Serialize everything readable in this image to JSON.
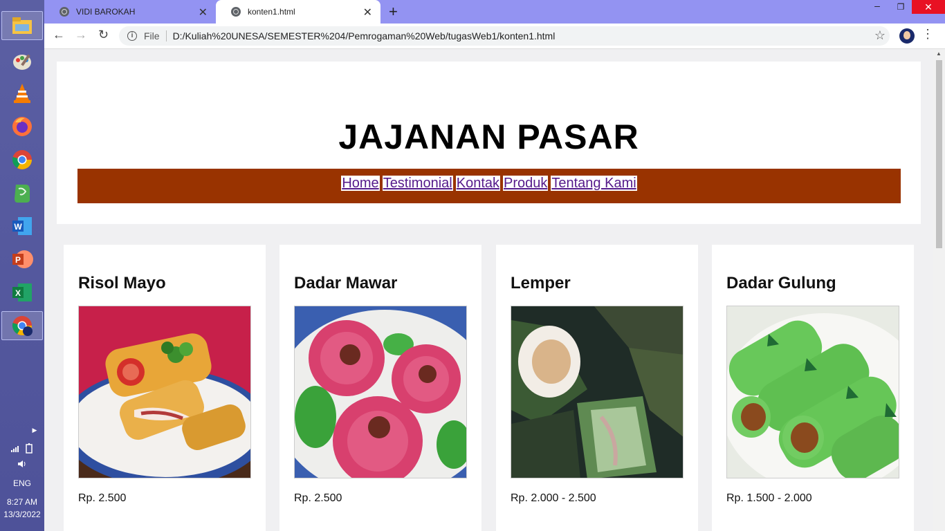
{
  "browser": {
    "tabs": [
      {
        "title": "VIDI BAROKAH"
      },
      {
        "title": "konten1.html"
      }
    ],
    "address": {
      "scheme_label": "File",
      "url": "D:/Kuliah%20UNESA/SEMESTER%204/Pemrogaman%20Web/tugasWeb1/konten1.html"
    }
  },
  "taskbar": {
    "apps": [
      "file-explorer-icon",
      "paint-icon",
      "vlc-icon",
      "firefox-icon",
      "chrome-icon",
      "evernote-icon",
      "word-icon",
      "powerpoint-icon",
      "excel-icon",
      "chrome-profile-icon"
    ],
    "language": "ENG",
    "time": "8:27 AM",
    "date": "13/3/2022"
  },
  "page": {
    "title": "JAJANAN PASAR",
    "nav": [
      "Home",
      "Testimonial",
      "Kontak",
      "Produk",
      "Tentang Kami"
    ],
    "products": [
      {
        "name": "Risol Mayo",
        "price": "Rp. 2.500"
      },
      {
        "name": "Dadar Mawar",
        "price": "Rp. 2.500"
      },
      {
        "name": "Lemper",
        "price": "Rp. 2.000 - 2.500"
      },
      {
        "name": "Dadar Gulung",
        "price": "Rp. 1.500 - 2.000"
      }
    ]
  },
  "colors": {
    "nav_bar": "#993300",
    "tab_strip": "#9393f2",
    "taskbar": "#5b5fa3"
  }
}
